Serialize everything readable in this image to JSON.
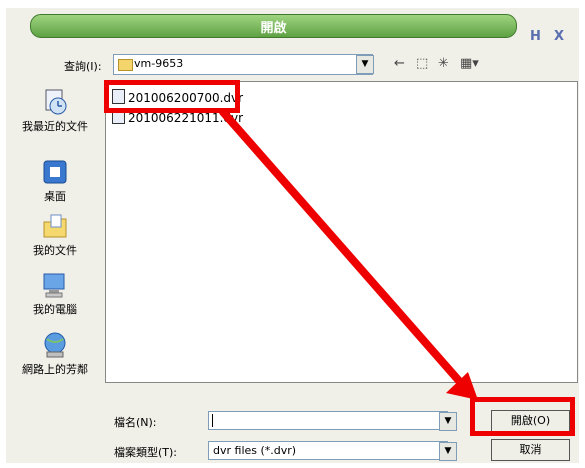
{
  "window": {
    "title": "開啟",
    "help_glyph": "H",
    "close_glyph": "X"
  },
  "toolbar": {
    "lookin_label": "查詢(I):",
    "lookin_value": "vm-9653",
    "back_glyph": "←",
    "up_glyph": "⬚",
    "newfolder_glyph": "✳",
    "view_glyph": "▦▾"
  },
  "places": [
    {
      "label": "我最近的文件",
      "icon": "recent-documents-icon"
    },
    {
      "label": "桌面",
      "icon": "desktop-icon"
    },
    {
      "label": "我的文件",
      "icon": "my-documents-icon"
    },
    {
      "label": "我的電腦",
      "icon": "my-computer-icon"
    },
    {
      "label": "網路上的芳鄰",
      "icon": "network-places-icon"
    }
  ],
  "files": [
    {
      "name": "201006200700.dvr"
    },
    {
      "name": "201006221011.dvr"
    }
  ],
  "filename": {
    "label": "檔名(N):",
    "value": ""
  },
  "filetype": {
    "label": "檔案類型(T):",
    "value": "dvr files (*.dvr)"
  },
  "buttons": {
    "open": "開啟(O)",
    "cancel": "取消"
  },
  "colors": {
    "highlight": "#ee0000",
    "title_green": "#5fa144"
  }
}
